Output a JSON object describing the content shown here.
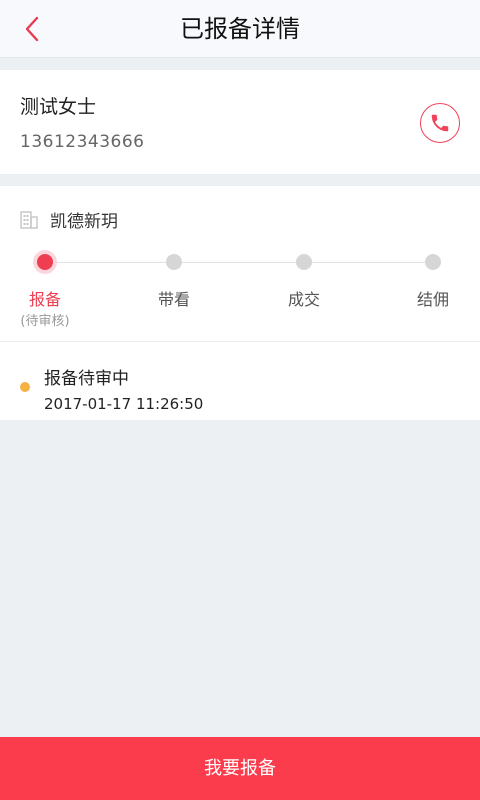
{
  "header": {
    "title": "已报备详情"
  },
  "customer": {
    "name": "测试女士",
    "phone": "13612343666"
  },
  "project": {
    "name": "凯德新玥"
  },
  "steps": [
    {
      "label": "报备",
      "sub": "(待审核)"
    },
    {
      "label": "带看"
    },
    {
      "label": "成交"
    },
    {
      "label": "结佣"
    }
  ],
  "status": {
    "text": "报备待审中",
    "time": "2017-01-17 11:26:50"
  },
  "footer": {
    "button_label": "我要报备"
  },
  "colors": {
    "accent": "#fb3c4c",
    "active_step": "#ef3d51",
    "pending_dot": "#f5b142",
    "inactive_step": "#d6d6d6"
  },
  "icons": {
    "back": "back-arrow-icon",
    "call": "phone-icon",
    "project": "building-icon"
  }
}
